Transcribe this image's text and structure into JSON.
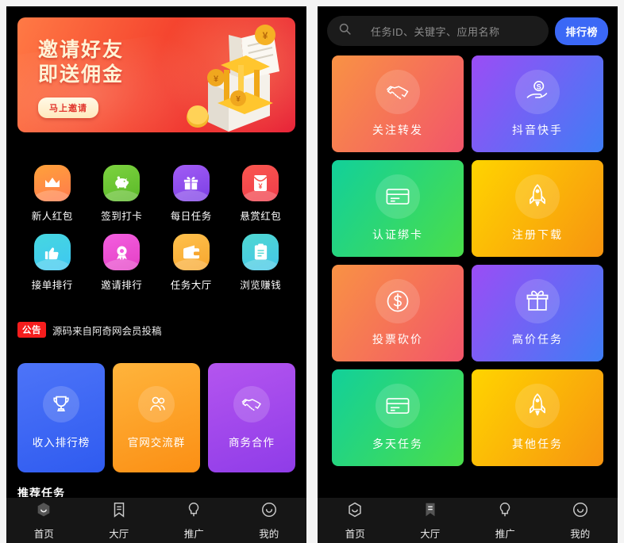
{
  "left_panel": {
    "banner": {
      "line1": "邀请好友",
      "line2": "即送佣金",
      "cta": "马上邀请",
      "icon": "bank-book-coins-illustration"
    },
    "icon_grid": [
      {
        "label": "新人红包",
        "icon": "crown-icon",
        "c1": "#ffa23a",
        "c2": "#ff7a4d"
      },
      {
        "label": "签到打卡",
        "icon": "piggy-bank-icon",
        "c1": "#7dd340",
        "c2": "#5ab828"
      },
      {
        "label": "每日任务",
        "icon": "gift-icon",
        "c1": "#a25cf5",
        "c2": "#7b3fe4"
      },
      {
        "label": "悬赏红包",
        "icon": "red-envelope-icon",
        "c1": "#f9574f",
        "c2": "#ef3b4a"
      },
      {
        "label": "接单排行",
        "icon": "thumbs-up-icon",
        "c1": "#46d7e0",
        "c2": "#3ec7f2"
      },
      {
        "label": "邀请排行",
        "icon": "medal-icon",
        "c1": "#f45fe0",
        "c2": "#e33fc4"
      },
      {
        "label": "任务大厅",
        "icon": "wallet-icon",
        "c1": "#ffc14d",
        "c2": "#f7a62e"
      },
      {
        "label": "浏览赚钱",
        "icon": "clipboard-icon",
        "c1": "#4fd8d2",
        "c2": "#44c6e8"
      }
    ],
    "notice": {
      "badge": "公告",
      "text": "源码来自阿奇网会员投稿"
    },
    "promo_cards": [
      {
        "label": "收入排行榜",
        "icon": "trophy-icon",
        "c1": "#4d74f8",
        "c2": "#2f5bf0"
      },
      {
        "label": "官网交流群",
        "icon": "people-group-icon",
        "c1": "#ffb43c",
        "c2": "#fb8f14"
      },
      {
        "label": "商务合作",
        "icon": "handshake-icon",
        "c1": "#b455ef",
        "c2": "#8f3ce8"
      }
    ],
    "section_clipped": "推荐任务"
  },
  "right_panel": {
    "search": {
      "placeholder": "任务ID、关键字、应用名称",
      "icon": "search-icon"
    },
    "rank_button": "排行榜",
    "task_cards": [
      {
        "label": "关注转发",
        "icon": "handshake-icon",
        "c1": "#f99244",
        "c2": "#f2556a"
      },
      {
        "label": "抖音快手",
        "icon": "hand-coin-icon",
        "c1": "#9b4df5",
        "c2": "#3f7df5"
      },
      {
        "label": "认证绑卡",
        "icon": "credit-card-icon",
        "c1": "#12d09a",
        "c2": "#4ade4a"
      },
      {
        "label": "注册下载",
        "icon": "rocket-icon",
        "c1": "#ffd400",
        "c2": "#f79410"
      },
      {
        "label": "投票砍价",
        "icon": "dollar-circle-icon",
        "c1": "#f99244",
        "c2": "#f2556a"
      },
      {
        "label": "高价任务",
        "icon": "gift-icon",
        "c1": "#9b4df5",
        "c2": "#3f7df5"
      },
      {
        "label": "多天任务",
        "icon": "credit-card-icon",
        "c1": "#12d09a",
        "c2": "#4ade4a"
      },
      {
        "label": "其他任务",
        "icon": "rocket-icon",
        "c1": "#ffd400",
        "c2": "#f79410"
      }
    ]
  },
  "bottom_nav": {
    "items": [
      {
        "label": "首页",
        "icon": "home-hexagon-icon"
      },
      {
        "label": "大厅",
        "icon": "bookmark-icon"
      },
      {
        "label": "推广",
        "icon": "lightbulb-icon"
      },
      {
        "label": "我的",
        "icon": "smile-circle-icon"
      }
    ],
    "left_active_index": 0,
    "right_active_index": 1
  }
}
